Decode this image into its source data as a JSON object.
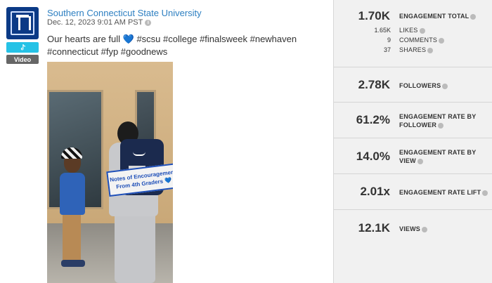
{
  "post": {
    "author": "Southern Connecticut State University",
    "timestamp": "Dec. 12, 2023 9:01 AM PST",
    "caption": "Our hearts are full 💙 #scsu #college #finalsweek #newhaven #connecticut #fyp #goodnews",
    "platform_icon": "tiktok-icon",
    "media_type_label": "Video",
    "photo_sign_text": "Notes of Encouragement From 4th Graders 💙"
  },
  "stats": {
    "engagement_total": {
      "value": "1.70K",
      "label": "ENGAGEMENT TOTAL"
    },
    "likes": {
      "value": "1.65K",
      "label": "LIKES"
    },
    "comments": {
      "value": "9",
      "label": "COMMENTS"
    },
    "shares": {
      "value": "37",
      "label": "SHARES"
    },
    "followers": {
      "value": "2.78K",
      "label": "FOLLOWERS"
    },
    "engagement_rate_follower": {
      "value": "61.2%",
      "label_line1": "ENGAGEMENT RATE BY",
      "label_line2": "FOLLOWER"
    },
    "engagement_rate_view": {
      "value": "14.0%",
      "label_line1": "ENGAGEMENT RATE BY",
      "label_line2": "VIEW"
    },
    "engagement_rate_lift": {
      "value": "2.01x",
      "label": "ENGAGEMENT RATE LIFT"
    },
    "views": {
      "value": "12.1K",
      "label": "VIEWS"
    }
  },
  "colors": {
    "link_blue": "#2d7fc1",
    "tiktok_badge": "#25c2e6",
    "avatar_blue": "#0b3a86",
    "panel_bg": "#f1f1f1"
  }
}
